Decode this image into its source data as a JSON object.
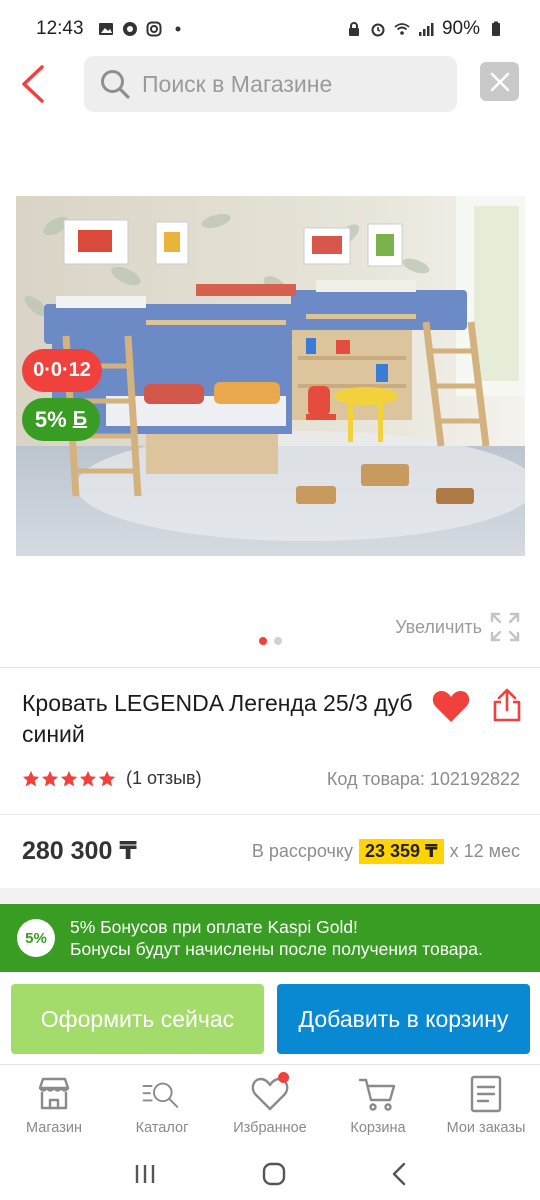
{
  "status_bar": {
    "time": "12:43",
    "battery": "90%"
  },
  "header": {
    "search_placeholder": "Поиск в Магазине"
  },
  "product": {
    "badge_timer": "0·0·12",
    "badge_bonus_percent": "5%",
    "badge_bonus_mark": "Б",
    "zoom_label": "Увеличить",
    "gallery_count": 2,
    "gallery_active": 1,
    "title": "Кровать LEGENDA Легенда 25/3 дуб синий",
    "rating_stars": 5,
    "reviews": "(1 отзыв)",
    "sku": "Код товара: 102192822",
    "price": "280 300 ₸",
    "installment_prefix": "В рассрочку",
    "installment_amount": "23 359 ₸",
    "installment_suffix": "х 12 мес"
  },
  "bonus_banner": {
    "badge": "5%",
    "line1": "5% Бонусов при оплате Kaspi Gold!",
    "line2": "Бонусы будут начислены после получения товара."
  },
  "actions": {
    "buy_now": "Оформить сейчас",
    "add_to_cart": "Добавить в корзину"
  },
  "tabs": [
    {
      "label": "Магазин",
      "icon": "store-icon"
    },
    {
      "label": "Каталог",
      "icon": "catalog-search-icon"
    },
    {
      "label": "Избранное",
      "icon": "heart-icon",
      "has_dot": true
    },
    {
      "label": "Корзина",
      "icon": "cart-icon"
    },
    {
      "label": "Мои заказы",
      "icon": "orders-icon"
    }
  ],
  "colors": {
    "accent_red": "#f1413c",
    "bonus_green": "#3a9d23",
    "buy_now_green": "#a3dc6a",
    "cart_blue": "#0a89d3",
    "installment_yellow": "#ffd400"
  }
}
